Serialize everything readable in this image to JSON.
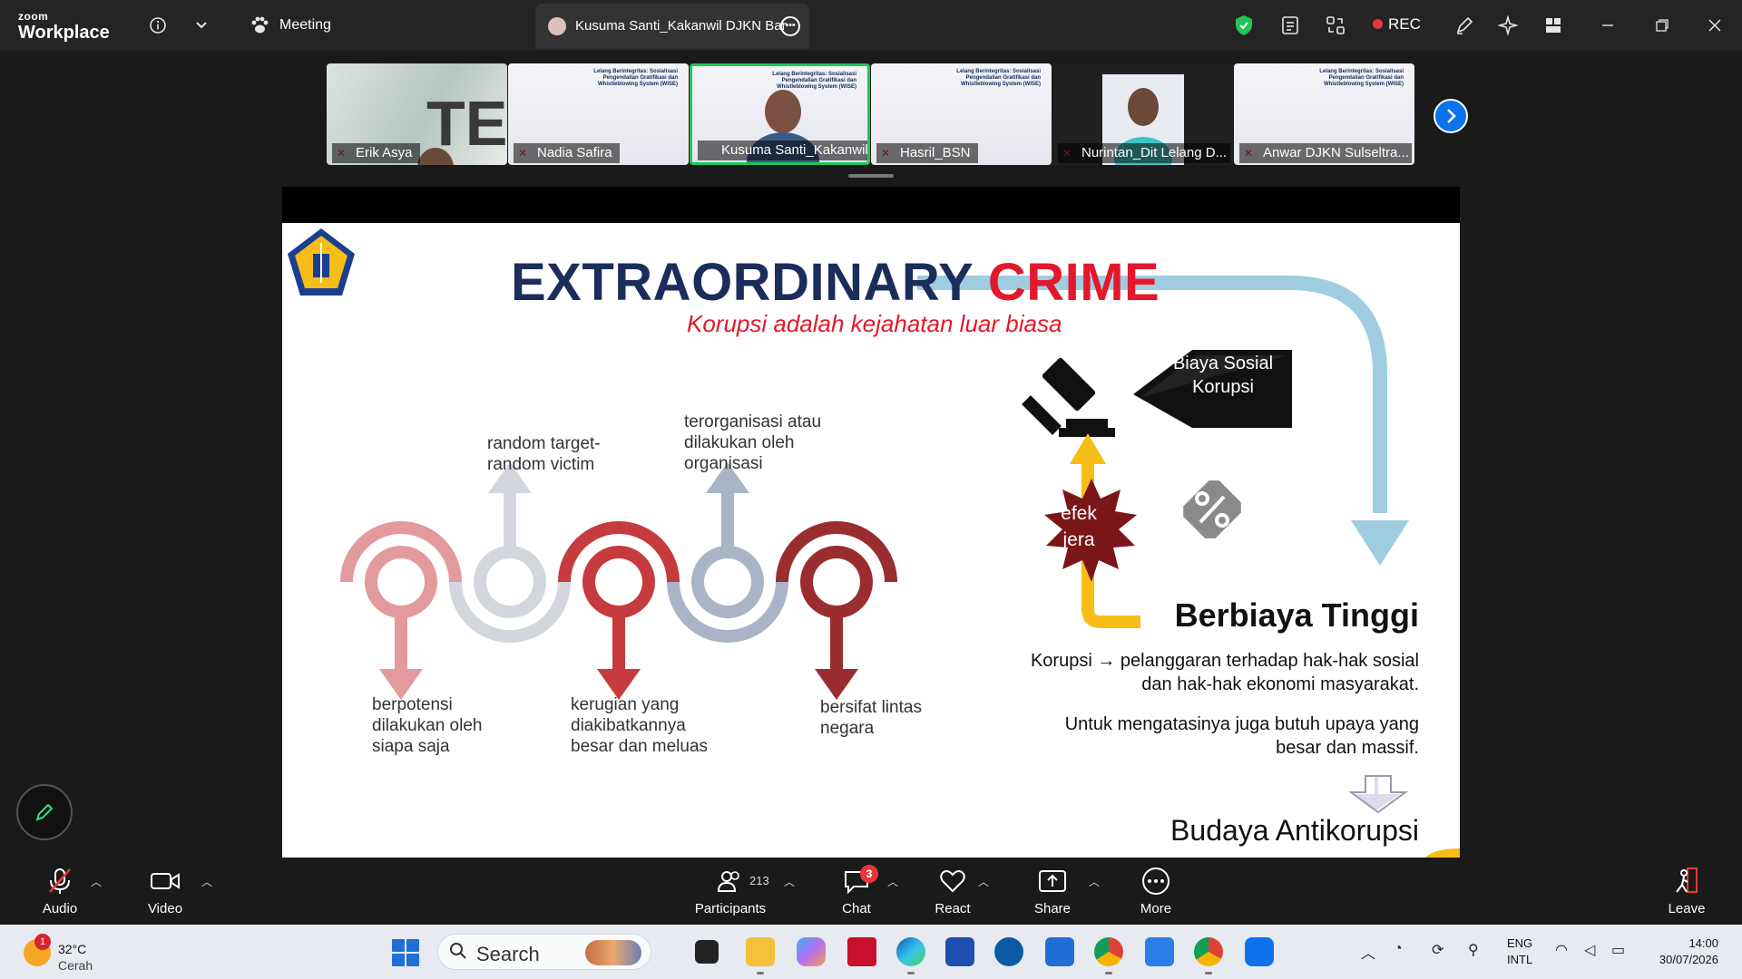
{
  "topbar": {
    "brand_small": "zoom",
    "brand_big": "Workplace",
    "meeting_label": "Meeting",
    "tab_title": "Kusuma Santi_Kakanwil DJKN Bar",
    "rec_label": "REC"
  },
  "thumbnails": [
    {
      "name": "Erik Asya",
      "type": "camera"
    },
    {
      "name": "Nadia Safira",
      "type": "slide"
    },
    {
      "name": "Kusuma Santi_Kakanwil D...",
      "type": "camera",
      "active": true
    },
    {
      "name": "Hasril_BSN",
      "type": "slide"
    },
    {
      "name": "Nurintan_Dit Lelang D...",
      "type": "camera"
    },
    {
      "name": "Anwar DJKN Sulseltra...",
      "type": "slide"
    }
  ],
  "thumb_slide_text": "Lelang Berintegritas: Sosialisasi Pengendalian Gratifikasi dan Whistleblowing System (WISE)",
  "slide": {
    "title_dark": "EXTRAORDINARY",
    "title_red": "CRIME",
    "subtitle": "Korupsi adalah kejahatan luar biasa",
    "up_labels": [
      "random target-\nrandom victim",
      "terorganisasi atau\ndilakukan oleh\norganisasi"
    ],
    "down_labels": [
      "berpotensi\ndilakukan oleh\nsiapa saja",
      "kerugian yang\ndiakibatkannya\nbesar dan meluas",
      "bersifat lintas\nnegara"
    ],
    "biaya_label": "Biaya Sosial\nKorupsi",
    "efek_label": "efek\njera",
    "berbiaya": "Berbiaya Tinggi",
    "korupsi_text": "Korupsi → pelanggaran terhadap hak-hak sosial dan hak-hak ekonomi masyarakat.",
    "mengatasi_text": "Untuk mengatasinya juga butuh upaya yang besar dan massif.",
    "budaya": "Budaya Antikorupsi",
    "colors": {
      "navy": "#1b2d5a",
      "red": "#e3182c",
      "light_blue": "#9ecde0",
      "yellow": "#f6bd16"
    }
  },
  "toolbar": {
    "audio": "Audio",
    "video": "Video",
    "participants": "Participants",
    "participants_count": "213",
    "chat": "Chat",
    "chat_badge": "3",
    "react": "React",
    "share": "Share",
    "more": "More",
    "leave": "Leave"
  },
  "taskbar": {
    "weather_badge": "1",
    "temp": "32°C",
    "condition": "Cerah",
    "search_label": "Search",
    "lang_1": "ENG",
    "lang_2": "INTL",
    "time": "14:00",
    "date": "30/07/2026"
  }
}
